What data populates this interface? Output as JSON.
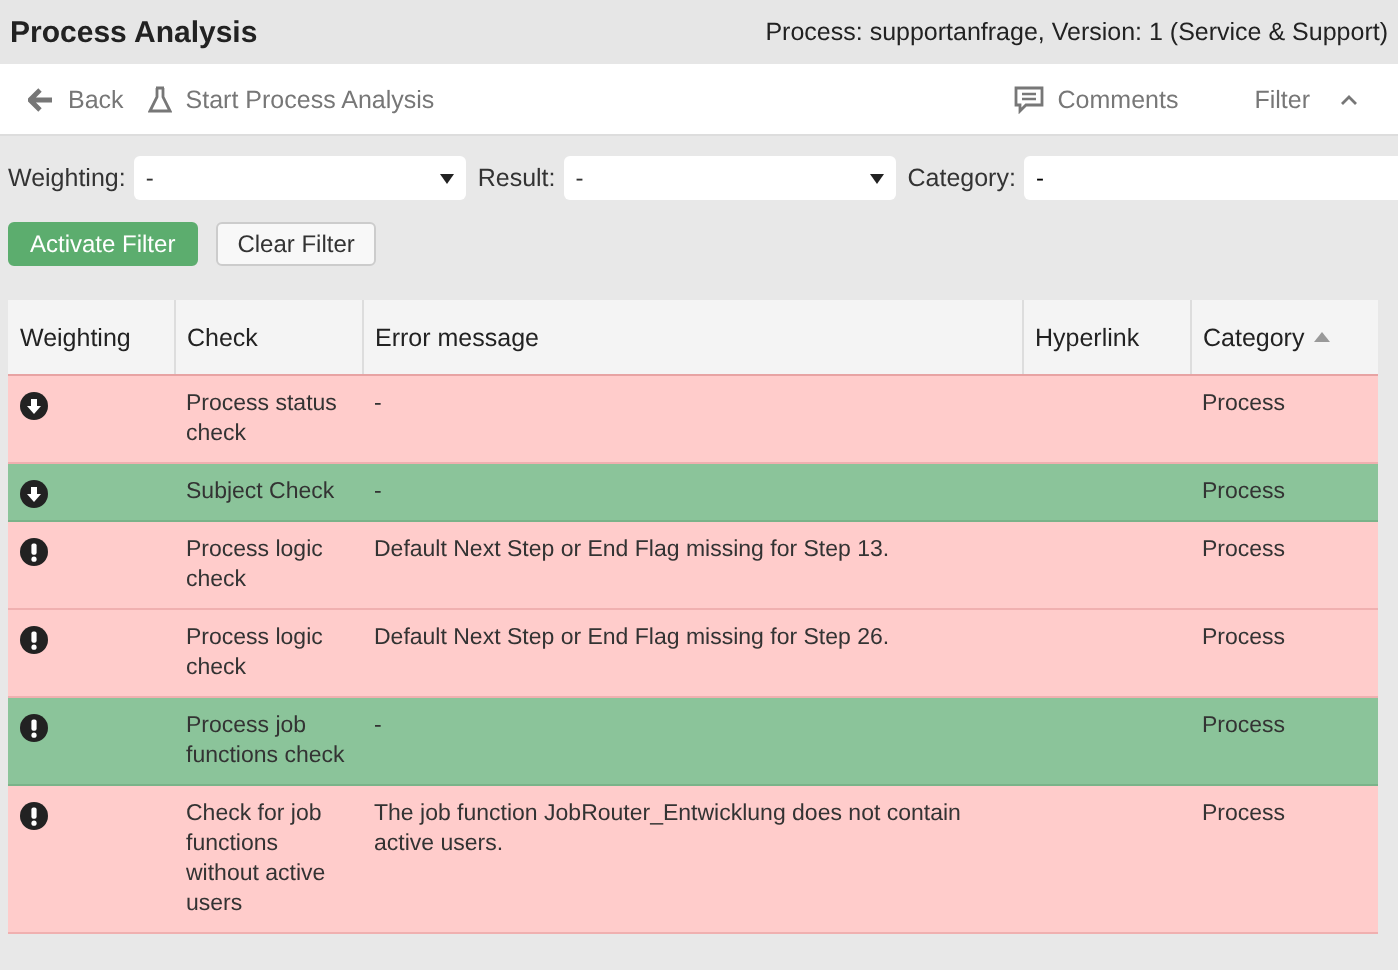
{
  "header": {
    "title": "Process Analysis",
    "process_info": "Process: supportanfrage, Version: 1 (Service & Support)"
  },
  "toolbar": {
    "back": "Back",
    "start": "Start Process Analysis",
    "comments": "Comments",
    "filter": "Filter",
    "filter_expanded": true
  },
  "filters": [
    {
      "label": "Weighting:",
      "value": "-",
      "kind": "select"
    },
    {
      "label": "Result:",
      "value": "-",
      "kind": "select"
    },
    {
      "label": "Category:",
      "value": "-",
      "kind": "text"
    }
  ],
  "filter_buttons": [
    {
      "label": "Activate Filter",
      "kind": "primary"
    },
    {
      "label": "Clear Filter",
      "kind": "default"
    }
  ],
  "table": {
    "columns": [
      {
        "label": "Weighting",
        "sorted": false
      },
      {
        "label": "Check",
        "sorted": false
      },
      {
        "label": "Error message",
        "sorted": false
      },
      {
        "label": "Hyperlink",
        "sorted": false
      },
      {
        "label": "Category",
        "sorted": true
      }
    ],
    "rows": [
      {
        "kind": "low",
        "passed": false,
        "check": "Process status check",
        "error": "-",
        "category": "Process"
      },
      {
        "kind": "low",
        "passed": true,
        "check": "Subject Check",
        "error": "-",
        "category": "Process"
      },
      {
        "kind": "high",
        "passed": false,
        "check": "Process logic check",
        "error": "Default Next Step or End Flag missing for Step 13.",
        "category": "Process"
      },
      {
        "kind": "high",
        "passed": false,
        "check": "Process logic check",
        "error": "Default Next Step or End Flag missing for Step 26.",
        "category": "Process"
      },
      {
        "kind": "high",
        "passed": true,
        "check": "Process job functions check",
        "error": "-",
        "category": "Process"
      },
      {
        "kind": "high",
        "passed": false,
        "check": "Check for job functions without active users",
        "error": "The job function JobRouter_Entwicklung does not contain active users.",
        "category": "Process"
      }
    ]
  }
}
